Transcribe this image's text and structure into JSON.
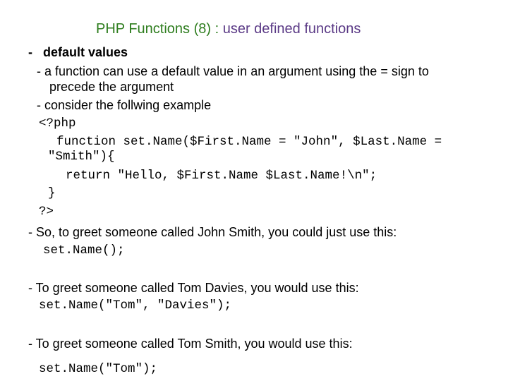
{
  "title": {
    "part1": "PHP Functions (8) :",
    "part2": " user defined functions",
    "color1": "#2e7d1e",
    "color2": "#5b3a86"
  },
  "lines": {
    "heading": "-   default values",
    "b1a": "- a function can use a default value in an argument using the = sign to",
    "b1b": "precede the argument",
    "b2": "- consider the follwing example",
    "c1": "<?php",
    "c2": "function set.Name($First.Name = \"John\", $Last.Name =",
    "c3": "\"Smith\"){",
    "c4": "return \"Hello, $First.Name $Last.Name!\\n\";",
    "c5": "}",
    "c6": "?>",
    "b3": "- So, to greet someone called John Smith, you could just use this:",
    "c7": "set.Name();",
    "b4": "- To greet someone called Tom Davies, you would use this:",
    "c8": "set.Name(\"Tom\", \"Davies\");",
    "b5": "- To greet someone called Tom Smith, you would use this:",
    "c9": "set.Name(\"Tom\");"
  }
}
